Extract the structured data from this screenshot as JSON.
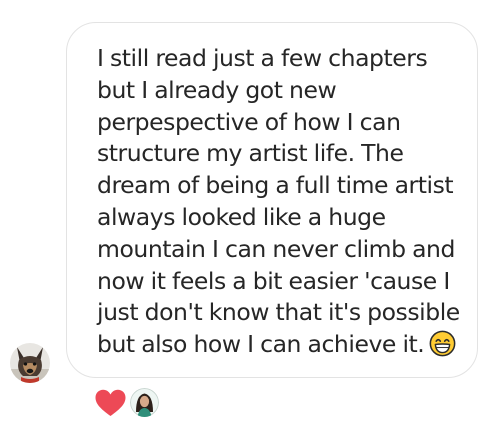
{
  "message": {
    "lines": [
      "I still read just a few chapters",
      "but I already got new",
      "perpespective of how I can",
      "structure my artist life. The",
      "dream of being a full time artist",
      "always looked like a huge",
      "mountain I can never climb and",
      "now it feels a bit easier 'cause I",
      "just don't know that it's possible",
      "but also how I can achieve it."
    ],
    "emoji": "grinning-face-with-smiling-eyes-icon"
  },
  "sender": {
    "avatar_icon": "dog-avatar-icon"
  },
  "reactions": {
    "icon": "red-heart-icon",
    "color": "#ed4956",
    "reactor_avatar_icon": "woman-avatar-icon"
  },
  "colors": {
    "text": "#262626",
    "bubble_border": "#e3e3e3",
    "heart": "#ed4956"
  }
}
